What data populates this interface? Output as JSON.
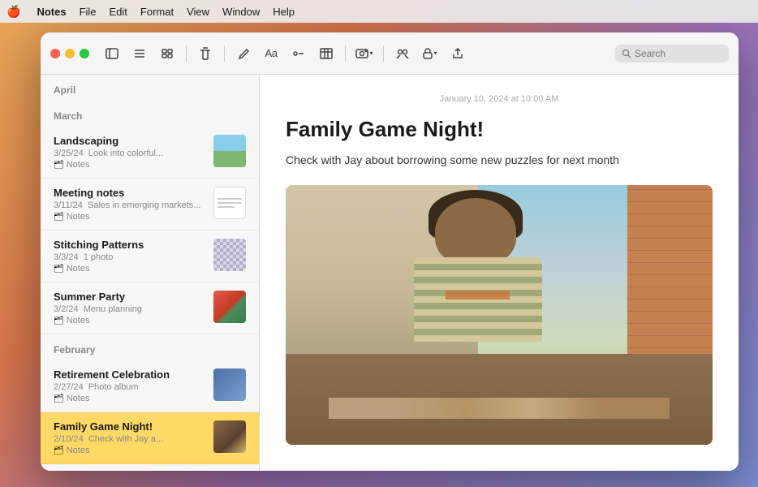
{
  "menubar": {
    "apple": "🍎",
    "items": [
      {
        "id": "notes-app",
        "label": "Notes",
        "bold": true
      },
      {
        "id": "file",
        "label": "File"
      },
      {
        "id": "edit",
        "label": "Edit"
      },
      {
        "id": "format",
        "label": "Format"
      },
      {
        "id": "view",
        "label": "View"
      },
      {
        "id": "window",
        "label": "Window"
      },
      {
        "id": "help",
        "label": "Help"
      }
    ]
  },
  "toolbar": {
    "search_placeholder": "Search"
  },
  "sidebar": {
    "sections": [
      {
        "id": "april",
        "header": "April",
        "notes": []
      },
      {
        "id": "march",
        "header": "March",
        "notes": [
          {
            "id": "landscaping",
            "title": "Landscaping",
            "date": "3/25/24",
            "preview": "Look into colorful...",
            "folder": "Notes",
            "thumb_type": "landscape",
            "selected": false
          },
          {
            "id": "meeting-notes",
            "title": "Meeting notes",
            "date": "3/11/24",
            "preview": "Sales in emerging markets...",
            "folder": "Notes",
            "thumb_type": "meeting",
            "selected": false
          },
          {
            "id": "stitching-patterns",
            "title": "Stitching Patterns",
            "date": "3/3/24",
            "preview": "1 photo",
            "folder": "Notes",
            "thumb_type": "stitch",
            "selected": false
          },
          {
            "id": "summer-party",
            "title": "Summer Party",
            "date": "3/2/24",
            "preview": "Menu planning",
            "folder": "Notes",
            "thumb_type": "summer",
            "selected": false
          }
        ]
      },
      {
        "id": "february",
        "header": "February",
        "notes": [
          {
            "id": "retirement-celebration",
            "title": "Retirement Celebration",
            "date": "2/27/24",
            "preview": "Photo album",
            "folder": "Notes",
            "thumb_type": "retirement",
            "selected": false
          },
          {
            "id": "family-game-night",
            "title": "Family Game Night!",
            "date": "2/10/24",
            "preview": "Check with Jay a...",
            "folder": "Notes",
            "thumb_type": "game",
            "selected": true
          }
        ]
      }
    ]
  },
  "note_detail": {
    "date": "January 10, 2024 at 10:00 AM",
    "title": "Family Game Night!",
    "body": "Check with Jay about borrowing some new puzzles for next month"
  }
}
